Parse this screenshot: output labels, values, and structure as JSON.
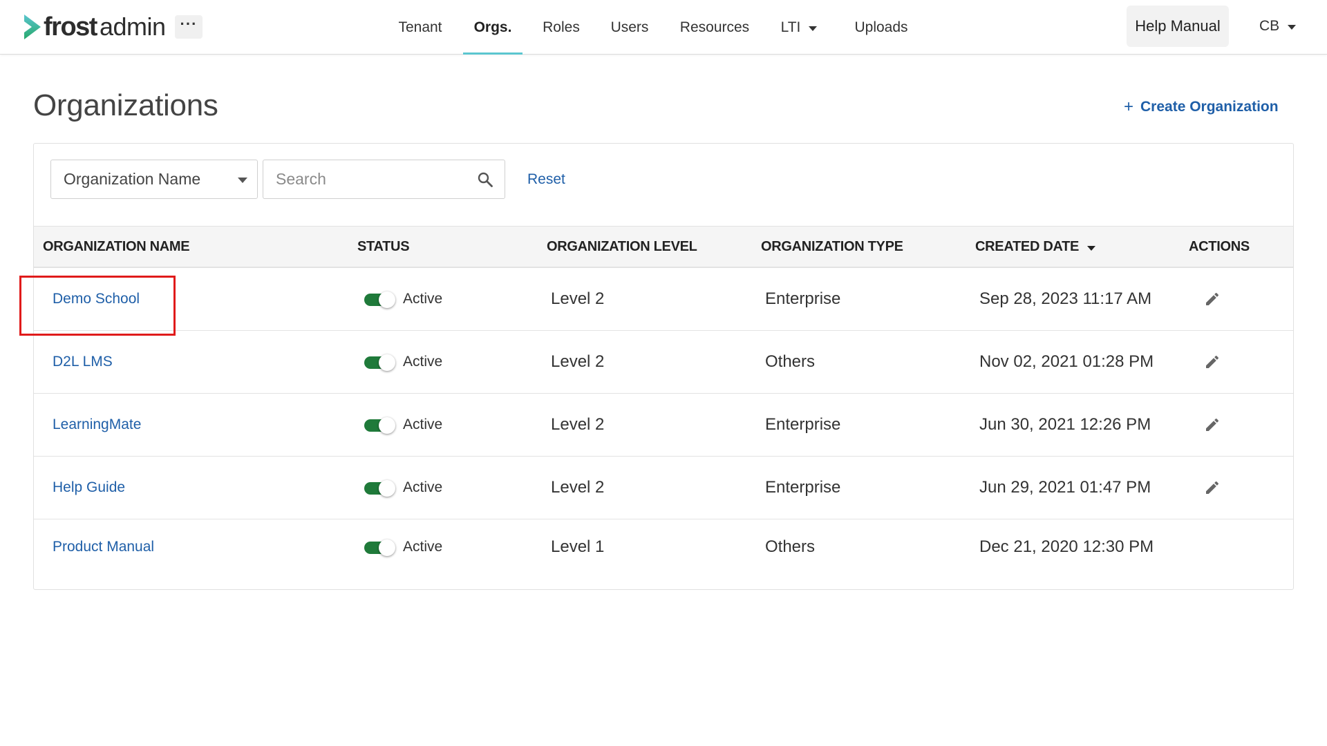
{
  "app": {
    "logo_bold": "frost",
    "logo_light": "admin",
    "more_label": "···"
  },
  "nav": {
    "items": [
      {
        "label": "Tenant",
        "active": false
      },
      {
        "label": "Orgs.",
        "active": true
      },
      {
        "label": "Roles",
        "active": false
      },
      {
        "label": "Users",
        "active": false
      },
      {
        "label": "Resources",
        "active": false
      },
      {
        "label": "LTI",
        "active": false,
        "dropdown": true
      },
      {
        "label": "Uploads",
        "active": false
      }
    ],
    "help_label": "Help Manual",
    "user_initials": "CB"
  },
  "page": {
    "title": "Organizations",
    "create_label": "Create Organization",
    "create_icon": "plus-icon"
  },
  "filters": {
    "field_select_value": "Organization Name",
    "search_placeholder": "Search",
    "search_value": "",
    "reset_label": "Reset"
  },
  "table": {
    "columns": [
      "ORGANIZATION NAME",
      "STATUS",
      "ORGANIZATION LEVEL",
      "ORGANIZATION TYPE",
      "CREATED DATE",
      "ACTIONS"
    ],
    "sort_column": "CREATED DATE",
    "sort_direction": "descending",
    "rows": [
      {
        "name": "Demo School",
        "status": "Active",
        "status_on": true,
        "level": "Level 2",
        "type": "Enterprise",
        "created": "Sep 28, 2023 11:17 AM",
        "editable": true
      },
      {
        "name": "D2L LMS",
        "status": "Active",
        "status_on": true,
        "level": "Level 2",
        "type": "Others",
        "created": "Nov 02, 2021 01:28 PM",
        "editable": true
      },
      {
        "name": "LearningMate",
        "status": "Active",
        "status_on": true,
        "level": "Level 2",
        "type": "Enterprise",
        "created": "Jun 30, 2021 12:26 PM",
        "editable": true
      },
      {
        "name": "Help Guide",
        "status": "Active",
        "status_on": true,
        "level": "Level 2",
        "type": "Enterprise",
        "created": "Jun 29, 2021 01:47 PM",
        "editable": true
      },
      {
        "name": "Product Manual",
        "status": "Active",
        "status_on": true,
        "level": "Level 1",
        "type": "Others",
        "created": "Dec 21, 2020 12:30 PM",
        "editable": false
      }
    ]
  },
  "colors": {
    "link": "#1f5fa8",
    "active_tab_underline": "#5bc6cf",
    "toggle_on": "#1f7a3a",
    "highlight": "#e01b1b",
    "logo_chevron_top": "#5bc6cf",
    "logo_chevron_bottom": "#27a86b"
  }
}
